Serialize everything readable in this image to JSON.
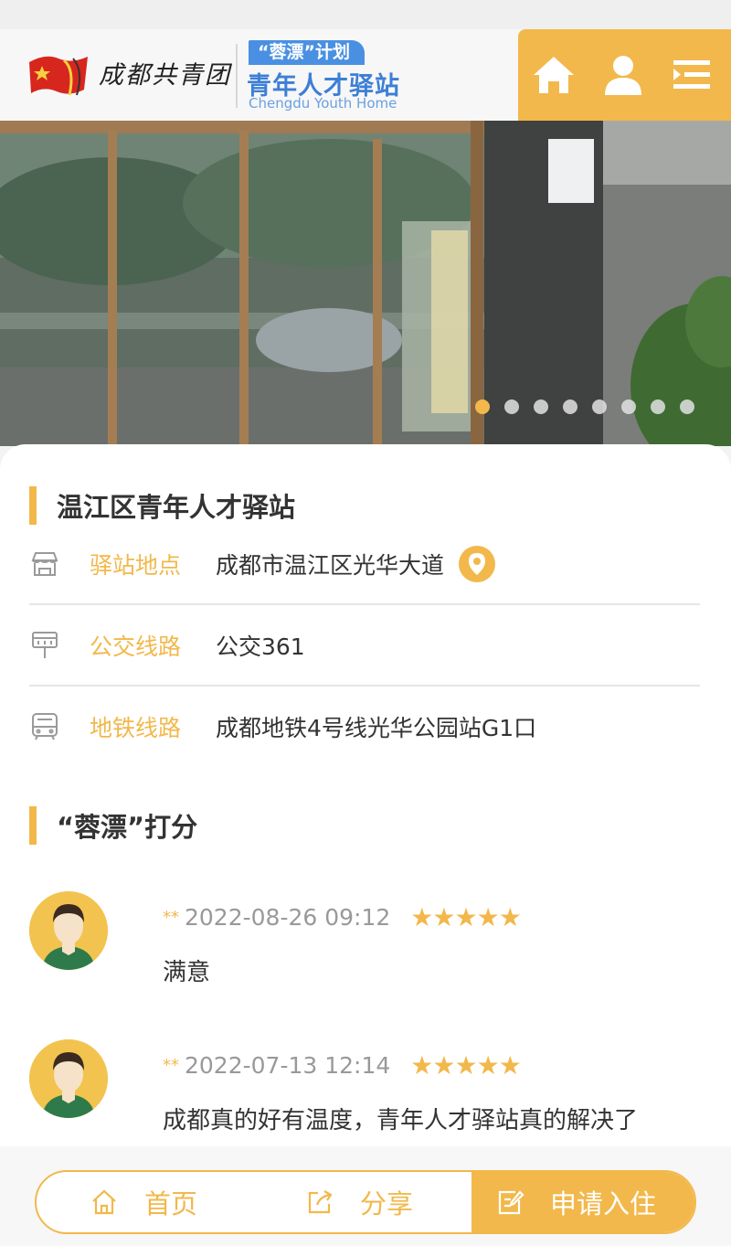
{
  "header": {
    "org_name": "成都共青团",
    "plan_badge": "“蓉漂”计划",
    "title": "青年人才驿站",
    "subtitle": "Chengdu Youth Home",
    "nav_icons": [
      "home-icon",
      "user-icon",
      "menu-icon"
    ]
  },
  "carousel": {
    "total": 8,
    "active": 1
  },
  "station": {
    "name": "温江区青年人才驿站",
    "rows": [
      {
        "icon": "store-icon",
        "label": "驿站地点",
        "value": "成都市温江区光华大道"
      },
      {
        "icon": "bus-stop-icon",
        "label": "公交线路",
        "value": "公交361"
      },
      {
        "icon": "metro-icon",
        "label": "地铁线路",
        "value": "成都地铁4号线光华公园站G1口"
      }
    ]
  },
  "reviews": {
    "title": "“蓉漂”打分",
    "items": [
      {
        "user": "**",
        "time": "2022-08-26 09:12",
        "stars": "★★★★★",
        "rating": 5,
        "text": "满意"
      },
      {
        "user": "**",
        "time": "2022-07-13 12:14",
        "stars": "★★★★★",
        "rating": 5,
        "text": "成都真的好有温度，青年人才驿站真的解决了"
      }
    ]
  },
  "bottom_nav": {
    "home": "首页",
    "share": "分享",
    "apply": "申请入住"
  },
  "colors": {
    "accent": "#f2b84b",
    "brand_blue": "#3d7fd6"
  }
}
